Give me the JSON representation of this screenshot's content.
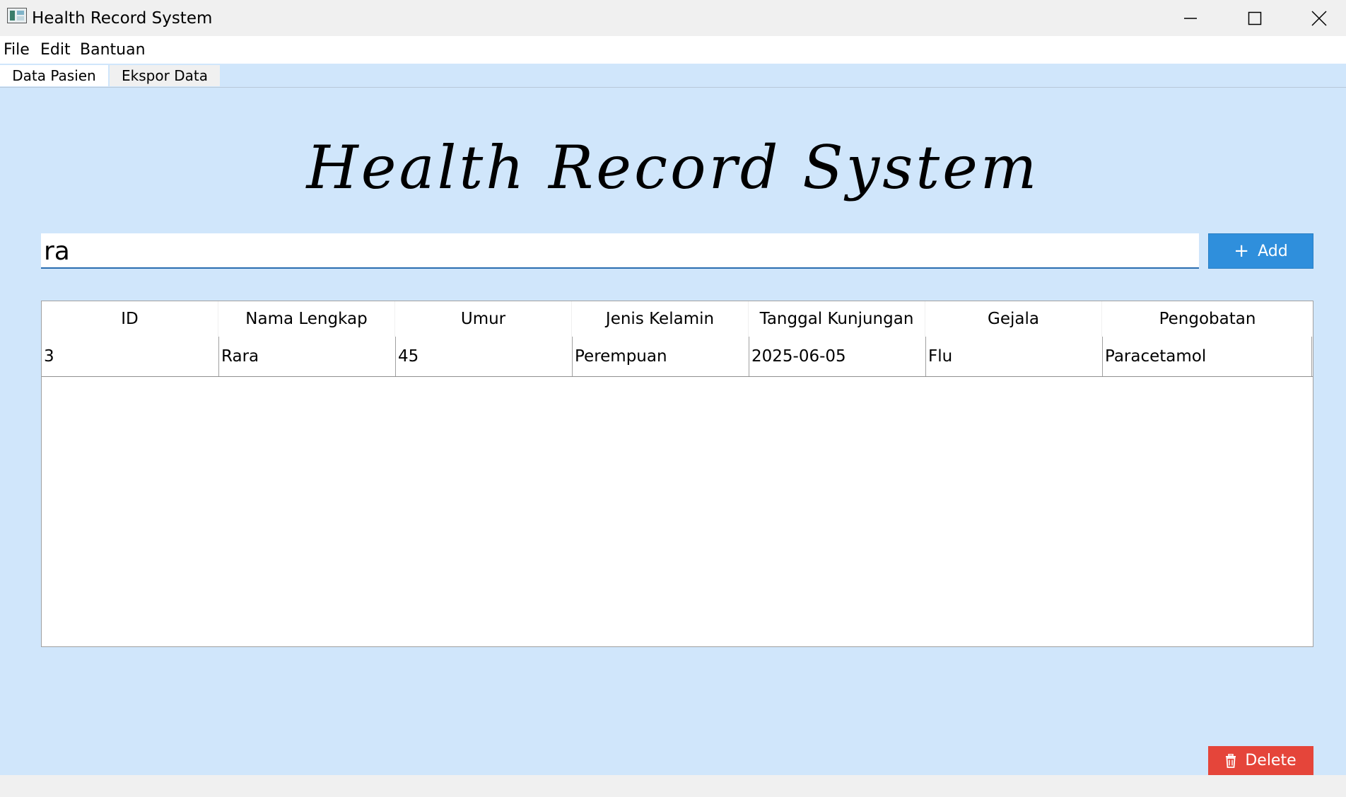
{
  "window": {
    "title": "Health Record System",
    "icon": "app-icon",
    "controls": [
      "minimize-icon",
      "maximize-icon",
      "close-icon"
    ]
  },
  "menu": {
    "items": [
      {
        "label": "File"
      },
      {
        "label": "Edit"
      },
      {
        "label": "Bantuan"
      }
    ]
  },
  "tabs": [
    {
      "label": "Data Pasien",
      "active": true
    },
    {
      "label": "Ekspor Data",
      "active": false
    }
  ],
  "main": {
    "heading": "Health Record System",
    "search": {
      "value": "ra"
    },
    "add_label": "Add",
    "add_icon": "plus-icon",
    "delete_label": "Delete",
    "delete_icon": "trash-icon"
  },
  "table": {
    "columns": [
      "ID",
      "Nama Lengkap",
      "Umur",
      "Jenis Kelamin",
      "Tanggal Kunjungan",
      "Gejala",
      "Pengobatan"
    ],
    "rows": [
      [
        "3",
        "Rara",
        "45",
        "Perempuan",
        "2025-06-05",
        "Flu",
        "Paracetamol"
      ]
    ]
  },
  "colors": {
    "content_bg": "#d0e6fb",
    "add_button": "#2f8fdc",
    "delete_button": "#e5453a",
    "search_underline": "#2a6db0"
  }
}
